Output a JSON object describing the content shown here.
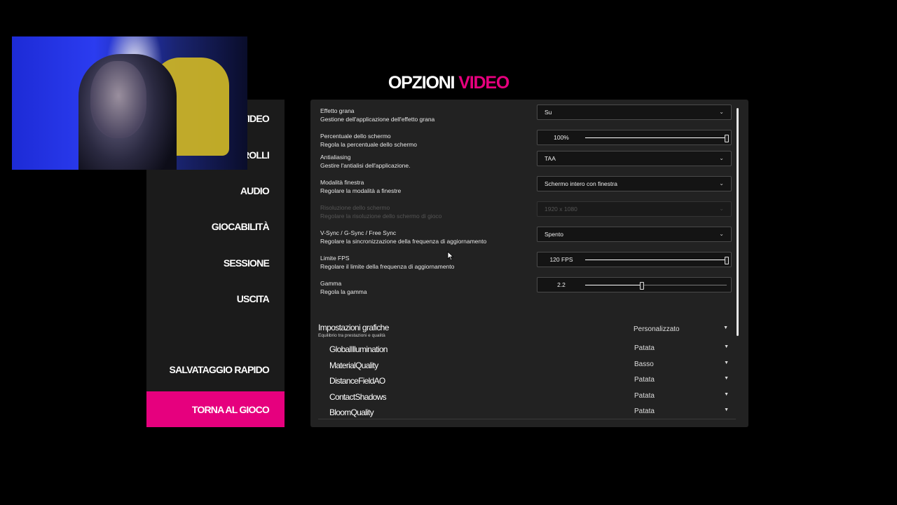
{
  "theme": {
    "accent": "#e6007e"
  },
  "title": {
    "word1": "OPZIONI",
    "word2": "VIDEO"
  },
  "menu": {
    "items": [
      {
        "label": "VIDEO"
      },
      {
        "label": "ROLLI"
      },
      {
        "label": "AUDIO"
      },
      {
        "label": "GIOCABILITÀ"
      },
      {
        "label": "SESSIONE"
      },
      {
        "label": "USCITA"
      },
      {
        "label": "SALVATAGGIO RAPIDO"
      }
    ],
    "back": "TORNA AL GIOCO"
  },
  "settings": [
    {
      "label": "Effetto grana",
      "desc": "Gestione dell'applicazione dell'effetto grana",
      "type": "dropdown",
      "value": "Su",
      "enabled": true
    },
    {
      "label": "Percentuale dello schermo",
      "desc": "Regola la percentuale dello schermo",
      "type": "slider",
      "value": "100%",
      "fraction": 1.0,
      "enabled": true
    },
    {
      "label": "Antialiasing",
      "desc": "Gestire l'antialisi dell'applicazione.",
      "type": "dropdown",
      "value": "TAA",
      "enabled": true
    },
    {
      "label": "Modalità finestra",
      "desc": "Regolare la modalità a finestre",
      "type": "dropdown",
      "value": "Schermo intero con finestra",
      "enabled": true
    },
    {
      "label": "Risoluzione dello schermo",
      "desc": "Regolare la risoluzione dello schermo di gioco",
      "type": "dropdown",
      "value": "1920 x 1080",
      "enabled": false
    },
    {
      "label": "V-Sync / G-Sync / Free Sync",
      "desc": "Regolare la sincronizzazione della frequenza di aggiornamento",
      "type": "dropdown",
      "value": "Spento",
      "enabled": true
    },
    {
      "label": "Limite FPS",
      "desc": "Regolare il limite della frequenza di aggiornamento",
      "type": "slider",
      "value": "120 FPS",
      "fraction": 1.0,
      "enabled": true
    },
    {
      "label": "Gamma",
      "desc": "Regola la gamma",
      "type": "slider",
      "value": "2.2",
      "fraction": 0.4,
      "enabled": true
    }
  ],
  "graphics": {
    "title": "Impostazioni grafiche",
    "subtitle": "Equilibrio tra prestazioni e qualità",
    "preset": "Personalizzato",
    "items": [
      {
        "name": "GlobalIllumination",
        "value": "Patata"
      },
      {
        "name": "MaterialQuality",
        "value": "Basso"
      },
      {
        "name": "DistanceFieldAO",
        "value": "Patata"
      },
      {
        "name": "ContactShadows",
        "value": "Patata"
      },
      {
        "name": "BloomQuality",
        "value": "Patata"
      }
    ]
  }
}
